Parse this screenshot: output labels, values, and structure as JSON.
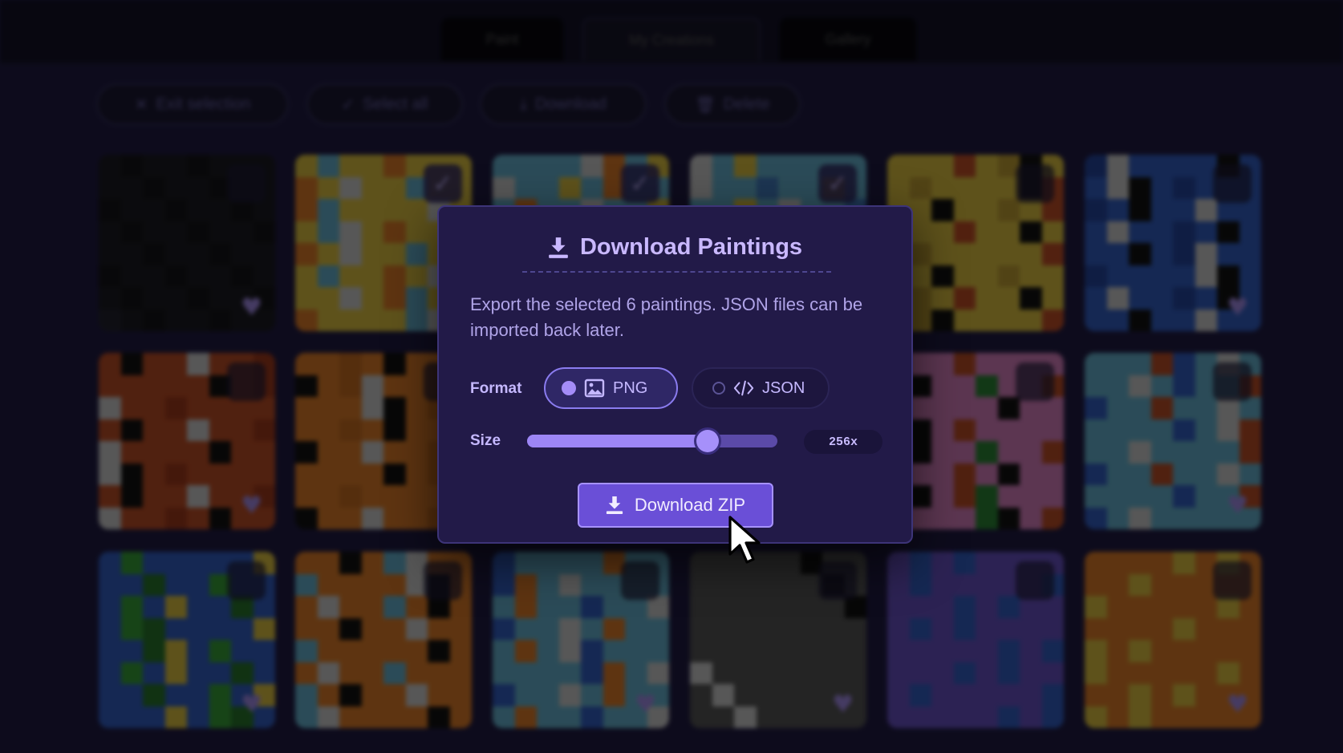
{
  "nav": {
    "tabs": [
      {
        "label": "Paint"
      },
      {
        "label": "My Creations"
      },
      {
        "label": "Gallery"
      }
    ]
  },
  "toolbar": {
    "exit_label": "Exit selection",
    "select_all_label": "Select all",
    "download_label": "Download",
    "delete_label": "Delete"
  },
  "dialog": {
    "title": "Download Paintings",
    "description": "Export the selected 6 paintings. JSON files can be imported back later.",
    "format_label": "Format",
    "formats": [
      {
        "label": "PNG",
        "selected": true
      },
      {
        "label": "JSON",
        "selected": false
      }
    ],
    "size_label": "Size",
    "size_value": "256x",
    "size_level": 0.72,
    "download_button": "Download ZIP"
  },
  "colors": {
    "accent": "#6a4fd7",
    "dialog_bg": "#221a48",
    "title": "#c9b8ff"
  }
}
